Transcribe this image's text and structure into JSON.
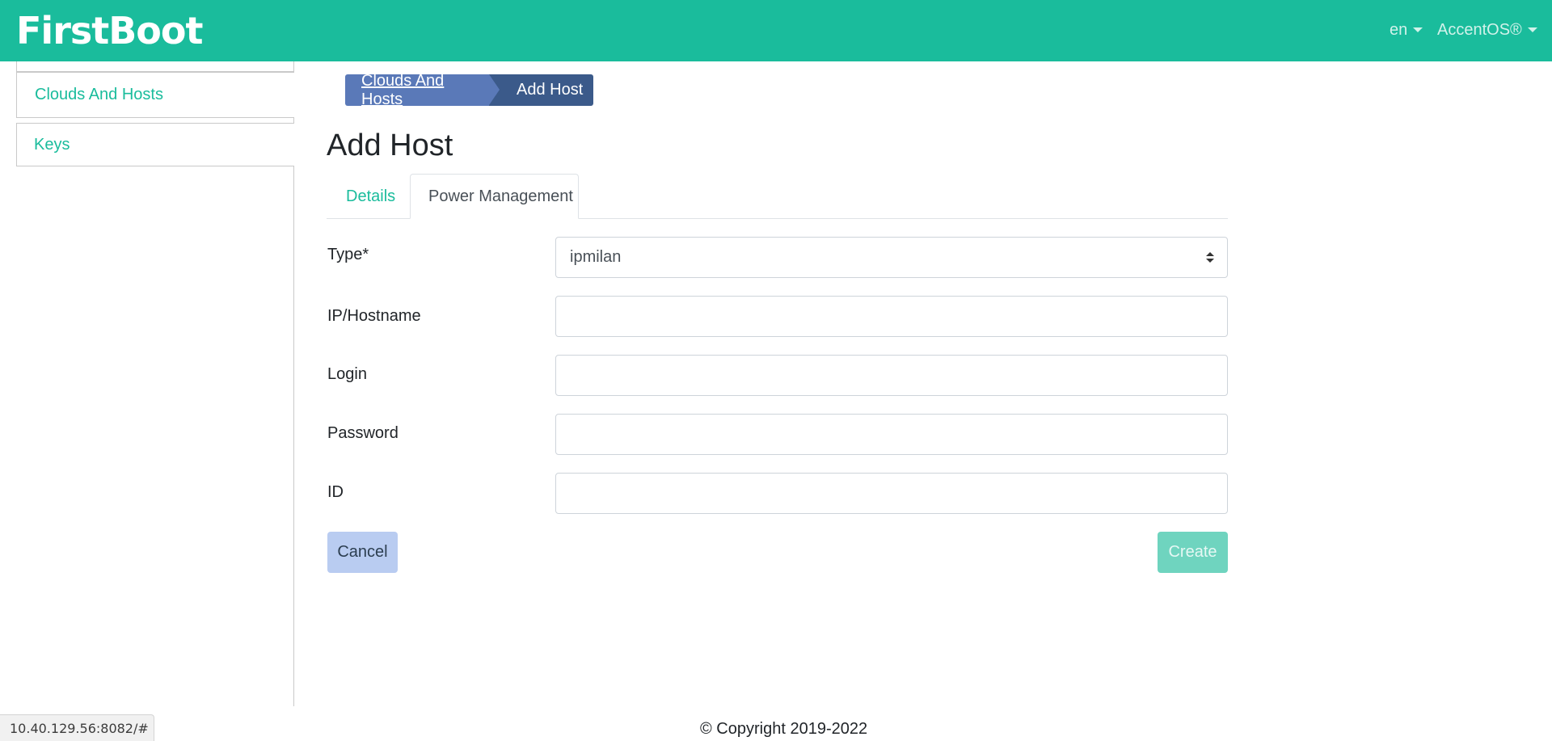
{
  "header": {
    "brand": "FirstBoot",
    "language": "en",
    "product": "AccentOS®"
  },
  "sidebar": {
    "items": [
      {
        "label": "Clouds And Hosts"
      },
      {
        "label": "Keys"
      }
    ]
  },
  "breadcrumb": {
    "parent": "Clouds And Hosts",
    "current": "Add Host"
  },
  "page": {
    "title": "Add Host"
  },
  "tabs": [
    {
      "label": "Details",
      "active": false
    },
    {
      "label": "Power Management",
      "active": true
    }
  ],
  "form": {
    "type_label": "Type*",
    "type_value": "ipmilan",
    "ip_label": "IP/Hostname",
    "ip_value": "",
    "login_label": "Login",
    "login_value": "",
    "password_label": "Password",
    "password_value": "",
    "id_label": "ID",
    "id_value": ""
  },
  "buttons": {
    "cancel": "Cancel",
    "create": "Create"
  },
  "footer": {
    "copyright": "© Copyright 2019-2022"
  },
  "status_bar": {
    "url": "10.40.129.56:8082/#"
  },
  "colors": {
    "brand": "#1abc9c",
    "breadcrumb_parent": "#5a79b8",
    "breadcrumb_current": "#3b5a8a",
    "cancel_button": "#b9ccf1",
    "create_button": "#6fd4bf"
  },
  "icons": {
    "language_dropdown": "caret-down-icon",
    "product_dropdown": "caret-down-icon",
    "select": "sort-arrows-icon"
  }
}
